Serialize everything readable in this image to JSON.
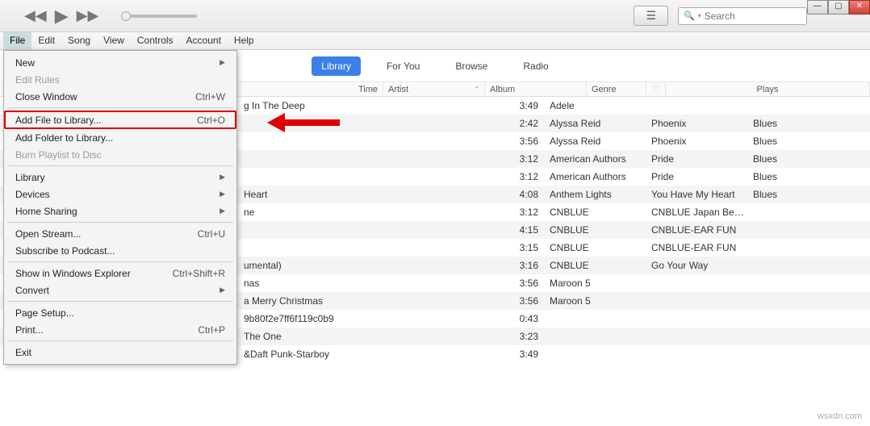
{
  "titlebar": {
    "search_placeholder": "Search"
  },
  "menubar": [
    "File",
    "Edit",
    "Song",
    "View",
    "Controls",
    "Account",
    "Help"
  ],
  "dropdown": [
    {
      "label": "New",
      "sub": true
    },
    {
      "label": "Edit Rules",
      "disabled": true
    },
    {
      "label": "Close Window",
      "shortcut": "Ctrl+W"
    },
    {
      "sep": true
    },
    {
      "label": "Add File to Library...",
      "shortcut": "Ctrl+O",
      "highlight": true
    },
    {
      "label": "Add Folder to Library..."
    },
    {
      "label": "Burn Playlist to Disc",
      "disabled": true
    },
    {
      "sep": true
    },
    {
      "label": "Library",
      "sub": true
    },
    {
      "label": "Devices",
      "sub": true
    },
    {
      "label": "Home Sharing",
      "sub": true
    },
    {
      "sep": true
    },
    {
      "label": "Open Stream...",
      "shortcut": "Ctrl+U"
    },
    {
      "label": "Subscribe to Podcast..."
    },
    {
      "sep": true
    },
    {
      "label": "Show in Windows Explorer",
      "shortcut": "Ctrl+Shift+R"
    },
    {
      "label": "Convert",
      "sub": true
    },
    {
      "sep": true
    },
    {
      "label": "Page Setup..."
    },
    {
      "label": "Print...",
      "shortcut": "Ctrl+P"
    },
    {
      "sep": true
    },
    {
      "label": "Exit"
    }
  ],
  "nav_tabs": [
    "Library",
    "For You",
    "Browse",
    "Radio"
  ],
  "columns": {
    "time": "Time",
    "artist": "Artist",
    "album": "Album",
    "genre": "Genre",
    "plays": "Plays"
  },
  "tracks": [
    {
      "name": "g In The Deep",
      "time": "3:49",
      "artist": "Adele",
      "album": "",
      "genre": ""
    },
    {
      "name": "",
      "time": "2:42",
      "artist": "Alyssa Reid",
      "album": "Phoenix",
      "genre": "Blues"
    },
    {
      "name": "",
      "time": "3:56",
      "artist": "Alyssa Reid",
      "album": "Phoenix",
      "genre": "Blues"
    },
    {
      "name": "",
      "time": "3:12",
      "artist": "American Authors",
      "album": "Pride",
      "genre": "Blues"
    },
    {
      "name": "",
      "time": "3:12",
      "artist": "American Authors",
      "album": "Pride",
      "genre": "Blues"
    },
    {
      "name": "Heart",
      "time": "4:08",
      "artist": "Anthem Lights",
      "album": "You Have My Heart",
      "genre": "Blues"
    },
    {
      "name": "ne",
      "time": "3:12",
      "artist": "CNBLUE",
      "album": "CNBLUE Japan Best...",
      "genre": ""
    },
    {
      "name": "",
      "time": "4:15",
      "artist": "CNBLUE",
      "album": "CNBLUE-EAR FUN",
      "genre": ""
    },
    {
      "name": "",
      "time": "3:15",
      "artist": "CNBLUE",
      "album": "CNBLUE-EAR FUN",
      "genre": ""
    },
    {
      "name": "umental)",
      "time": "3:16",
      "artist": "CNBLUE",
      "album": "Go Your Way",
      "genre": ""
    },
    {
      "name": "nas",
      "time": "3:56",
      "artist": "Maroon 5",
      "album": "",
      "genre": ""
    },
    {
      "name": "a Merry Christmas",
      "time": "3:56",
      "artist": "Maroon 5",
      "album": "",
      "genre": ""
    },
    {
      "name": "9b80f2e7ff6f119c0b9",
      "time": "0:43",
      "artist": "",
      "album": "",
      "genre": ""
    },
    {
      "name": "The One",
      "time": "3:23",
      "artist": "",
      "album": "",
      "genre": ""
    },
    {
      "name": "&Daft Punk-Starboy",
      "time": "3:49",
      "artist": "",
      "album": "",
      "genre": ""
    }
  ],
  "watermark": "wsxdn.com"
}
